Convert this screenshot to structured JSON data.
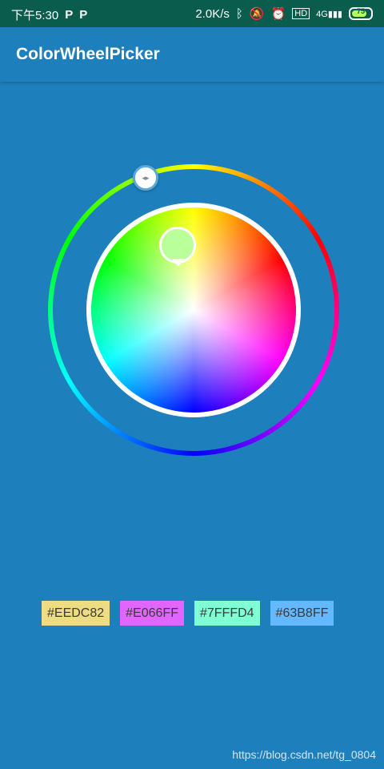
{
  "status_bar": {
    "time": "下午5:30",
    "left_badges": [
      "P",
      "P"
    ],
    "net_speed": "2.0K/s",
    "battery_level": "75",
    "icons": [
      "bluetooth-icon",
      "mute-bell-icon",
      "alarm-icon",
      "hd-icon",
      "4g-signal-icon"
    ]
  },
  "app_bar": {
    "title": "ColorWheelPicker"
  },
  "color_wheel": {
    "selected_color": "#b9ff9a"
  },
  "chips": [
    {
      "label": "#EEDC82",
      "color": "#EEDC82"
    },
    {
      "label": "#E066FF",
      "color": "#E066FF"
    },
    {
      "label": "#7FFFD4",
      "color": "#7FFFD4"
    },
    {
      "label": "#63B8FF",
      "color": "#63B8FF"
    }
  ],
  "watermark": "https://blog.csdn.net/tg_0804",
  "colors": {
    "background": "#1e7fbd",
    "status_bar": "#0a5c4c"
  }
}
